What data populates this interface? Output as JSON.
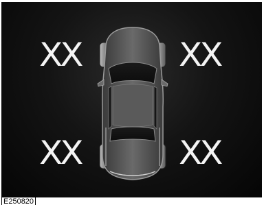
{
  "display": {
    "front_left_value": "XX",
    "front_right_value": "XX",
    "rear_left_value": "XX",
    "rear_right_value": "XX"
  },
  "figure_id": "E250820",
  "icons": {
    "vehicle": "car-top-view-icon"
  },
  "colors": {
    "background": "#0a0a0a",
    "text": "#f4f4f4",
    "car_body": "#555555"
  }
}
